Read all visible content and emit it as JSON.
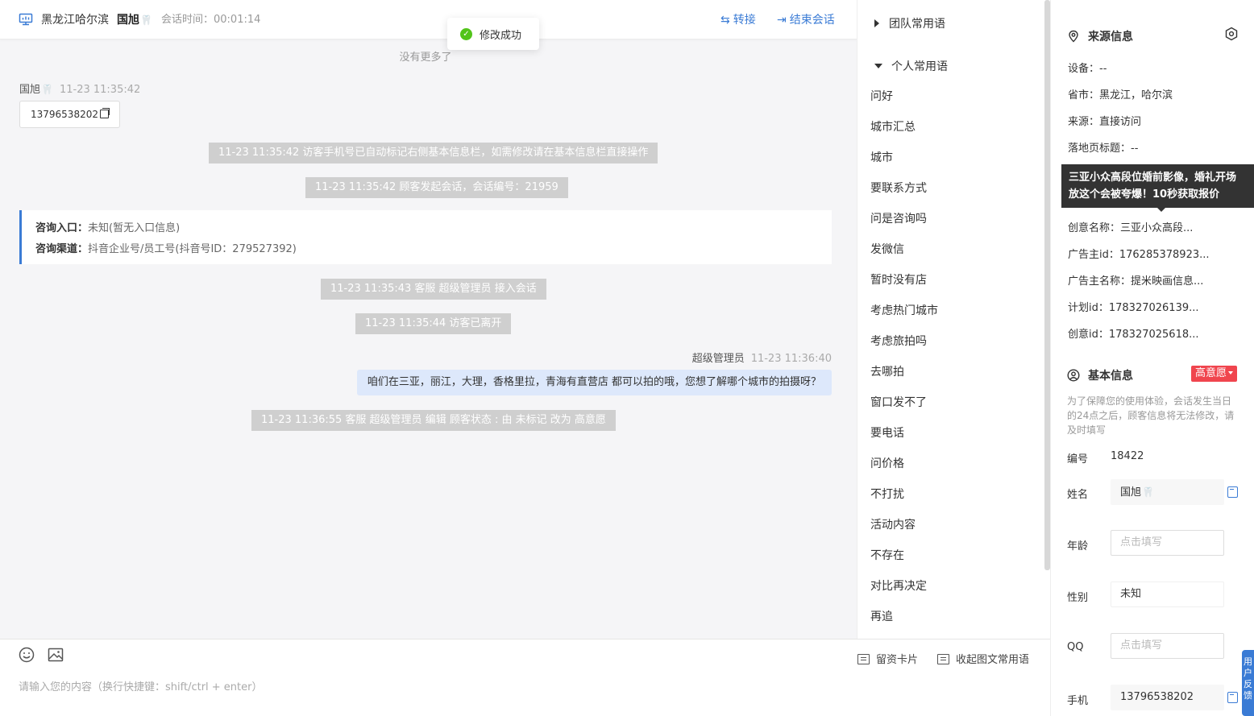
{
  "header": {
    "location": "黑龙江哈尔滨",
    "visitor_name": "国旭",
    "session_time_label": "会话时间：00:01:14",
    "transfer_label": "转接",
    "end_label": "结束会话"
  },
  "toast": {
    "text": "修改成功"
  },
  "chat": {
    "no_more": "没有更多了",
    "visitor_name": "国旭",
    "visitor_time": "11-23 11:35:42",
    "visitor_message": "13796538202",
    "system_messages": [
      "11-23 11:35:42 访客手机号已自动标记右侧基本信息栏，如需修改请在基本信息栏直接操作",
      "11-23 11:35:42 顾客发起会话，会话编号：21959",
      "11-23 11:35:43 客服 超级管理员 接入会话",
      "11-23 11:35:44 访客已离开",
      "11-23 11:36:55 客服 超级管理员 编辑 顾客状态 : 由 未标记 改为 高意愿"
    ],
    "entry_label": "咨询入口：",
    "entry_value": "未知(暂无入口信息)",
    "channel_label": "咨询渠道：",
    "channel_value": "抖音企业号/员工号(抖音号ID：279527392)",
    "agent_name": "超级管理员",
    "agent_time": "11-23 11:36:40",
    "agent_message": "咱们在三亚，丽江，大理，香格里拉，青海有直营店 都可以拍的哦，您想了解哪个城市的拍摄呀？"
  },
  "input": {
    "placeholder": "请输入您的内容（换行快捷键：shift/ctrl + enter）",
    "card_button": "留资卡片",
    "collapse_button": "收起图文常用语"
  },
  "phrases": {
    "team_group": "团队常用语",
    "personal_group": "个人常用语",
    "items": [
      "问好",
      "城市汇总",
      "城市",
      "要联系方式",
      "问是咨询吗",
      "发微信",
      "暂时没有店",
      "考虑热门城市",
      "考虑旅拍吗",
      "去哪拍",
      "窗口发不了",
      "要电话",
      "问价格",
      "不打扰",
      "活动内容",
      "不存在",
      "对比再决定",
      "再追"
    ]
  },
  "source": {
    "title": "来源信息",
    "rows": [
      "设备：--",
      "省市：黑龙江，哈尔滨",
      "来源：直接访问",
      "落地页标题：--",
      "创意名称：三亚小众高段...",
      "广告主id：176285378923...",
      "广告主名称：提米映画信息...",
      "计划id：178327026139...",
      "创意id：178327025618..."
    ],
    "tooltip_line1": "三亚小众高段位婚前影像，婚礼开场",
    "tooltip_line2": "放这个会被夸爆！10秒获取报价"
  },
  "basic": {
    "title": "基本信息",
    "intent_badge": "高意愿",
    "notice": "为了保障您的使用体验，会话发生当日的24点之后，顾客信息将无法修改，请及时填写",
    "id_label": "编号",
    "id_value": "18422",
    "name_label": "姓名",
    "name_value": "国旭",
    "age_label": "年龄",
    "age_placeholder": "点击填写",
    "gender_label": "性别",
    "gender_value": "未知",
    "qq_label": "QQ",
    "qq_placeholder": "点击填写",
    "phone_label": "手机",
    "phone_value": "13796538202"
  },
  "float_tab": {
    "label": "用户反馈"
  },
  "colors": {
    "accent": "#3a7bd5",
    "badge": "#f0454e",
    "success": "#52c41a",
    "system_msg_bg": "#cfcfcf",
    "agent_bubble": "#dde8fb"
  }
}
